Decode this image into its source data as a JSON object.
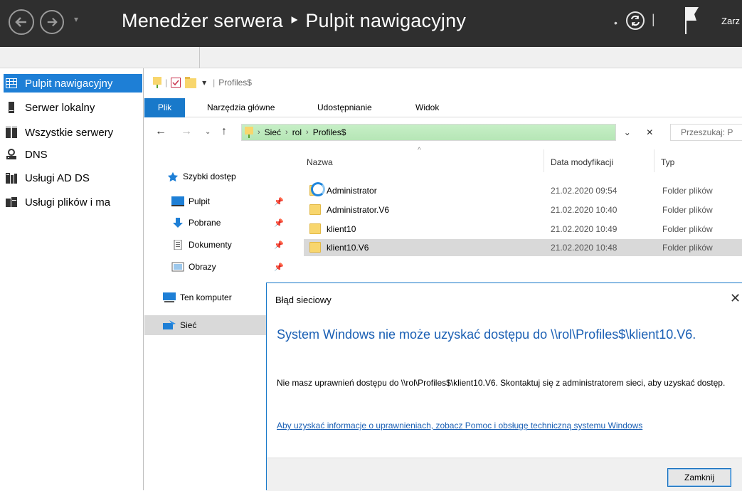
{
  "topbar": {
    "title": "Menedżer serwera ‣ Pulpit nawigacyjny",
    "manage_label": "Zarz",
    "nav_dropdown": "▾",
    "dropdown_dot": "•",
    "separator": "|"
  },
  "server_nav": {
    "items": [
      {
        "label": "Pulpit nawigacyjny",
        "icon": "dashboard-icon"
      },
      {
        "label": "Serwer lokalny",
        "icon": "server-icon"
      },
      {
        "label": "Wszystkie serwery",
        "icon": "servers-icon"
      },
      {
        "label": "DNS",
        "icon": "dns-icon"
      },
      {
        "label": "Usługi AD DS",
        "icon": "ad-ds-icon"
      },
      {
        "label": "Usługi plików i ma",
        "icon": "file-services-icon"
      }
    ]
  },
  "explorer": {
    "quick_access_title": "Profiles$",
    "quick_access_dropdown": "▾",
    "ribbon_tabs": [
      "Plik",
      "Narzędzia główne",
      "Udostępnianie",
      "Widok"
    ],
    "address": {
      "crumbs": [
        "Sieć",
        "rol",
        "Profiles$"
      ],
      "dropdown": "⌄",
      "clear": "✕"
    },
    "search_placeholder": "Przeszukaj: P",
    "nav_pane": {
      "quick_access": "Szybki dostęp",
      "pinned": [
        "Pulpit",
        "Pobrane",
        "Dokumenty",
        "Obrazy"
      ],
      "this_pc": "Ten komputer",
      "network": "Sieć"
    },
    "columns": {
      "name": "Nazwa",
      "date": "Data modyfikacji",
      "type": "Typ"
    },
    "files": [
      {
        "name": "Administrator",
        "date": "21.02.2020 09:54",
        "type": "Folder plików"
      },
      {
        "name": "Administrator.V6",
        "date": "21.02.2020 10:40",
        "type": "Folder plików"
      },
      {
        "name": "klient10",
        "date": "21.02.2020 10:49",
        "type": "Folder plików"
      },
      {
        "name": "klient10.V6",
        "date": "21.02.2020 10:48",
        "type": "Folder plików"
      }
    ]
  },
  "dialog": {
    "title": "Błąd sieciowy",
    "heading": "System Windows nie może uzyskać dostępu do \\\\rol\\Profiles$\\klient10.V6.",
    "body": "Nie masz uprawnień dostępu do \\\\rol\\Profiles$\\klient10.V6. Skontaktuj się z administratorem sieci, aby uzyskać dostęp.",
    "link": "Aby uzyskać informacje o uprawnieniach, zobacz Pomoc i obsługę techniczną systemu Windows",
    "close_button": "Zamknij",
    "close_glyph": "✕"
  }
}
